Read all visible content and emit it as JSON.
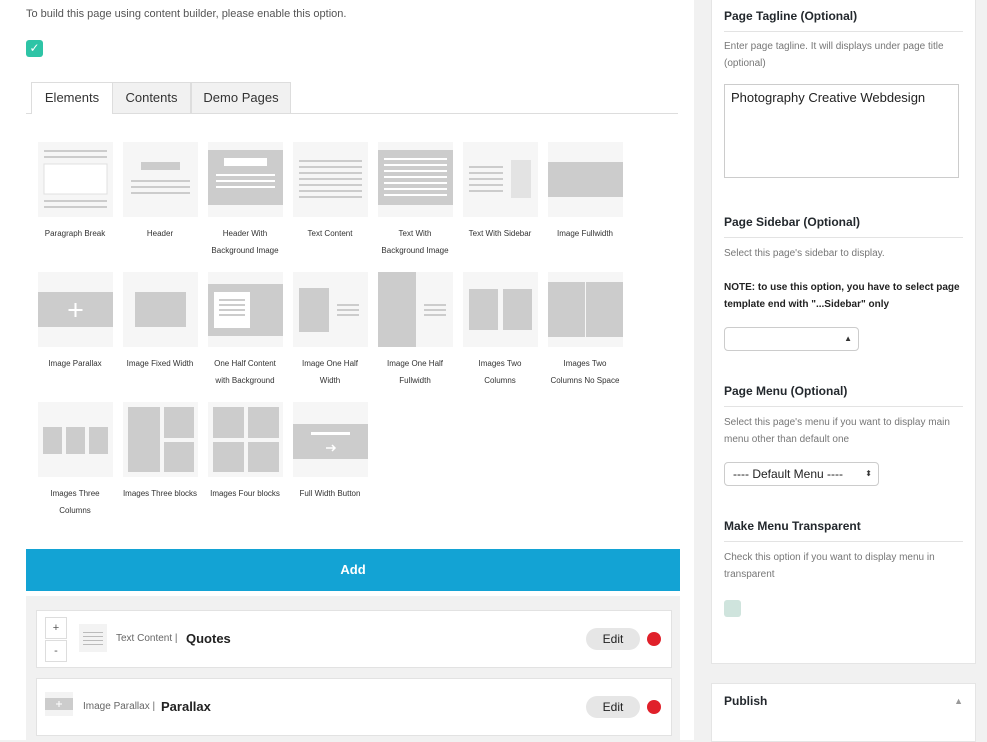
{
  "notice": "To build this page using content builder, please enable this option.",
  "tabs": [
    "Elements",
    "Contents",
    "Demo Pages"
  ],
  "elements": [
    [
      "Paragraph Break",
      ""
    ],
    [
      "Header",
      ""
    ],
    [
      "Header With",
      "Background Image"
    ],
    [
      "Text Content",
      ""
    ],
    [
      "Text With",
      "Background Image"
    ],
    [
      "Text With Sidebar",
      ""
    ],
    [
      "Image Fullwidth",
      ""
    ],
    [
      "Image Parallax",
      ""
    ],
    [
      "Image Fixed Width",
      ""
    ],
    [
      "One Half Content",
      "with Background"
    ],
    [
      "Image One Half",
      "Width"
    ],
    [
      "Image One Half",
      "Fullwidth"
    ],
    [
      "Images Two",
      "Columns"
    ],
    [
      "Images Two",
      "Columns No Space"
    ],
    [
      "Images Three",
      "Columns"
    ],
    [
      "Images Three blocks",
      ""
    ],
    [
      "Images Four blocks",
      ""
    ],
    [
      "Full Width Button",
      ""
    ]
  ],
  "add_label": "Add",
  "items": [
    {
      "type": "Text Content |",
      "title": "Quotes",
      "edit": "Edit"
    },
    {
      "type": "Image Parallax |",
      "title": "Parallax",
      "edit": "Edit"
    }
  ],
  "controls": {
    "plus": "+",
    "minus": "-"
  },
  "sidebar": {
    "tagline_heading": "Page Tagline (Optional)",
    "tagline_desc": "Enter page tagline. It will displays under page title (optional)",
    "tagline_value": "Photography Creative Webdesign",
    "sidebar_heading": "Page Sidebar (Optional)",
    "sidebar_desc": "Select this page's sidebar to display.",
    "sidebar_note": "NOTE: to use this option, you have to select page template end with \"...Sidebar\" only",
    "sidebar_select": "",
    "menu_heading": "Page Menu (Optional)",
    "menu_desc": "Select this page's menu if you want to display main menu other than default one",
    "menu_select": "---- Default Menu ----",
    "transparent_heading": "Make Menu Transparent",
    "transparent_desc": "Check this option if you want to display menu in transparent"
  },
  "publish": {
    "title": "Publish"
  },
  "colors": {
    "accent": "#13a3d4",
    "toggle": "#2ec4a6",
    "remove": "#e0202a"
  }
}
